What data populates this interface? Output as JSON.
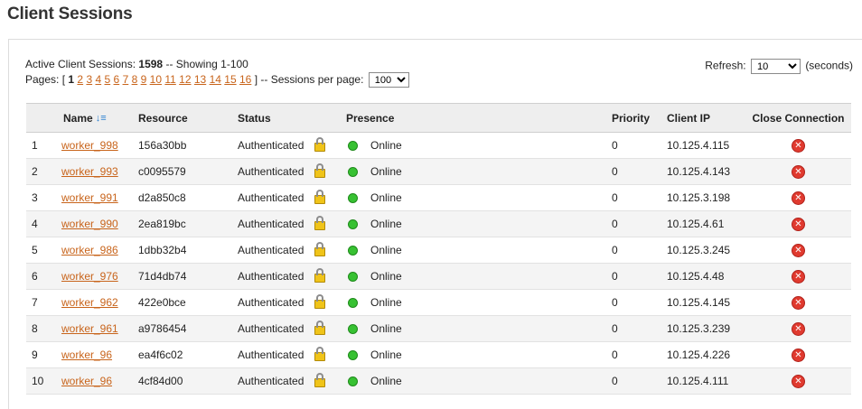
{
  "page_title": "Client Sessions",
  "summary": {
    "prefix": "Active Client Sessions:",
    "count": "1598",
    "showing": "-- Showing 1-100"
  },
  "pagination": {
    "label": "Pages: [",
    "current": "1",
    "pages": [
      "2",
      "3",
      "4",
      "5",
      "6",
      "7",
      "8",
      "9",
      "10",
      "11",
      "12",
      "13",
      "14",
      "15",
      "16"
    ],
    "close": "]",
    "per_page_label": "-- Sessions per page:",
    "per_page_value": "100"
  },
  "refresh": {
    "label": "Refresh:",
    "value": "10",
    "unit": "(seconds)"
  },
  "columns": [
    "",
    "Name",
    "Resource",
    "Status",
    "Presence",
    "Priority",
    "Client IP",
    "Close Connection"
  ],
  "icons": {
    "sort": "sort-descending-icon",
    "lock": "lock-icon",
    "presence": "online-dot-icon",
    "close": "close-connection-icon"
  },
  "colors": {
    "link": "#c8641b",
    "online": "#37c132",
    "close": "#e03a2f"
  },
  "sessions": [
    {
      "num": "1",
      "name": "worker_998",
      "resource": "156a30bb",
      "status": "Authenticated",
      "presence": "Online",
      "priority": "0",
      "ip": "10.125.4.115"
    },
    {
      "num": "2",
      "name": "worker_993",
      "resource": "c0095579",
      "status": "Authenticated",
      "presence": "Online",
      "priority": "0",
      "ip": "10.125.4.143"
    },
    {
      "num": "3",
      "name": "worker_991",
      "resource": "d2a850c8",
      "status": "Authenticated",
      "presence": "Online",
      "priority": "0",
      "ip": "10.125.3.198"
    },
    {
      "num": "4",
      "name": "worker_990",
      "resource": "2ea819bc",
      "status": "Authenticated",
      "presence": "Online",
      "priority": "0",
      "ip": "10.125.4.61"
    },
    {
      "num": "5",
      "name": "worker_986",
      "resource": "1dbb32b4",
      "status": "Authenticated",
      "presence": "Online",
      "priority": "0",
      "ip": "10.125.3.245"
    },
    {
      "num": "6",
      "name": "worker_976",
      "resource": "71d4db74",
      "status": "Authenticated",
      "presence": "Online",
      "priority": "0",
      "ip": "10.125.4.48"
    },
    {
      "num": "7",
      "name": "worker_962",
      "resource": "422e0bce",
      "status": "Authenticated",
      "presence": "Online",
      "priority": "0",
      "ip": "10.125.4.145"
    },
    {
      "num": "8",
      "name": "worker_961",
      "resource": "a9786454",
      "status": "Authenticated",
      "presence": "Online",
      "priority": "0",
      "ip": "10.125.3.239"
    },
    {
      "num": "9",
      "name": "worker_96",
      "resource": "ea4f6c02",
      "status": "Authenticated",
      "presence": "Online",
      "priority": "0",
      "ip": "10.125.4.226"
    },
    {
      "num": "10",
      "name": "worker_96",
      "resource": "4cf84d00",
      "status": "Authenticated",
      "presence": "Online",
      "priority": "0",
      "ip": "10.125.4.111"
    }
  ]
}
